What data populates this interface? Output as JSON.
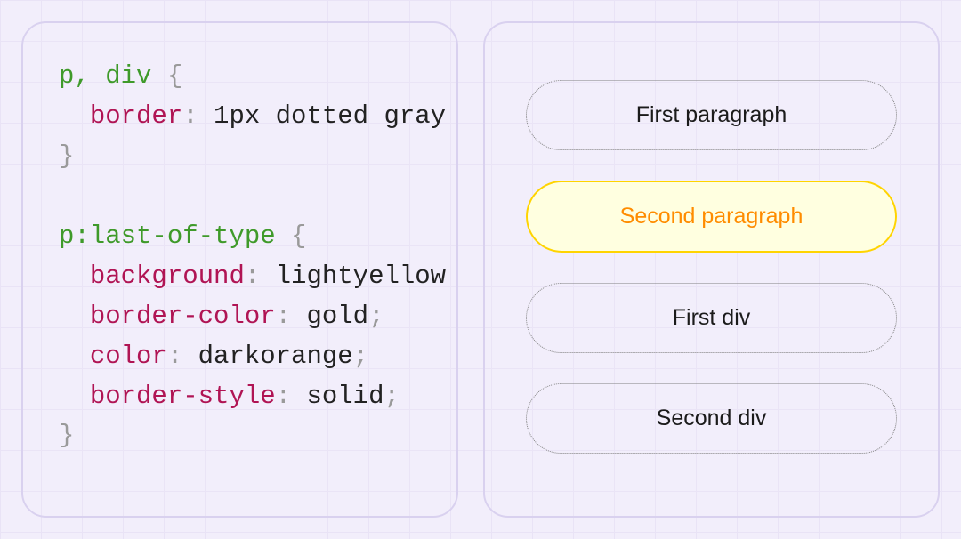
{
  "code": {
    "rule1": {
      "selector": "p, div",
      "decl": {
        "prop": "border",
        "val": "1px dotted gray"
      }
    },
    "rule2": {
      "selector": "p:last-of-type",
      "d1": {
        "prop": "background",
        "val": "lightyellow"
      },
      "d2": {
        "prop": "border-color",
        "val": "gold"
      },
      "d3": {
        "prop": "color",
        "val": "darkorange"
      },
      "d4": {
        "prop": "border-style",
        "val": "solid"
      }
    }
  },
  "render": {
    "p1": "First paragraph",
    "p2": "Second paragraph",
    "d1": "First div",
    "d2": "Second div"
  },
  "colors": {
    "panelBorder": "#d9d1ef",
    "pageBg": "#f2eefb",
    "highlightBg": "#ffffe0",
    "highlightBorder": "#ffd400",
    "highlightText": "#ff8c00"
  }
}
